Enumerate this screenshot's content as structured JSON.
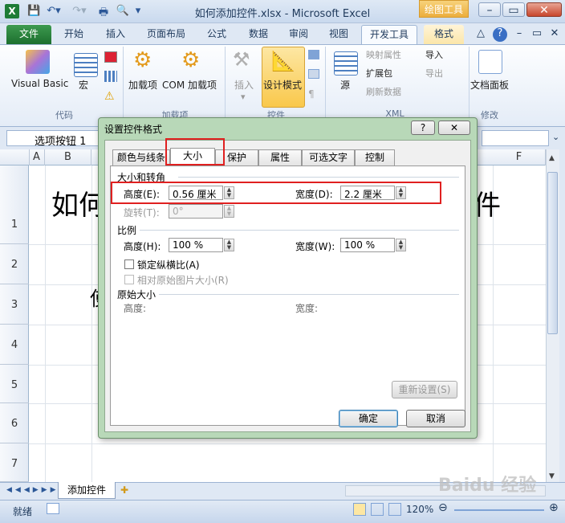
{
  "window": {
    "title": "如何添加控件.xlsx - Microsoft Excel",
    "context_tab": "绘图工具",
    "app_icon": "X"
  },
  "tabs": {
    "file": "文件",
    "home": "开始",
    "insert": "插入",
    "layout": "页面布局",
    "formulas": "公式",
    "data": "数据",
    "review": "审阅",
    "view": "视图",
    "developer": "开发工具",
    "format": "格式"
  },
  "ribbon": {
    "visual_basic": "Visual Basic",
    "macro": "宏",
    "code_group": "代码",
    "addins": "加载项",
    "com_addins": "COM 加载项",
    "addins_group": "加载项",
    "insert": "插入",
    "design_mode": "设计模式",
    "controls_group": "控件",
    "source": "源",
    "map_props": "映射属性",
    "expansion": "扩展包",
    "refresh": "刷新数据",
    "import": "导入",
    "export": "导出",
    "xml_group": "XML",
    "doc_panel": "文档面板",
    "modify_group": "修改"
  },
  "formula_bar": {
    "name_box": "选项按钮 1"
  },
  "grid": {
    "columns": [
      "A",
      "B",
      "F"
    ],
    "rows": [
      "1",
      "2",
      "3",
      "4",
      "5",
      "6",
      "7"
    ],
    "cell_text_left": "如何",
    "cell_text_right": "件",
    "cell_text_row3": "使"
  },
  "sheet": {
    "tab": "添加控件"
  },
  "status": {
    "ready": "就绪",
    "zoom": "120%"
  },
  "dialog": {
    "title": "设置控件格式",
    "help": "?",
    "close": "✕",
    "tabs": [
      "颜色与线条",
      "大小",
      "保护",
      "属性",
      "可选文字",
      "控制"
    ],
    "sec_size_rotate": "大小和转角",
    "height_label": "高度(E):",
    "height_value": "0.56 厘米",
    "width_label": "宽度(D):",
    "width_value": "2.2 厘米",
    "rotate_label": "旋转(T):",
    "rotate_value": "0°",
    "sec_scale": "比例",
    "scale_h_label": "高度(H):",
    "scale_h_value": "100 %",
    "scale_w_label": "宽度(W):",
    "scale_w_value": "100 %",
    "lock_ratio": "锁定纵横比(A)",
    "relative_orig": "相对原始图片大小(R)",
    "sec_original": "原始大小",
    "orig_h": "高度:",
    "orig_w": "宽度:",
    "reset": "重新设置(S)",
    "ok": "确定",
    "cancel": "取消"
  },
  "watermark": "Baidu 经验"
}
